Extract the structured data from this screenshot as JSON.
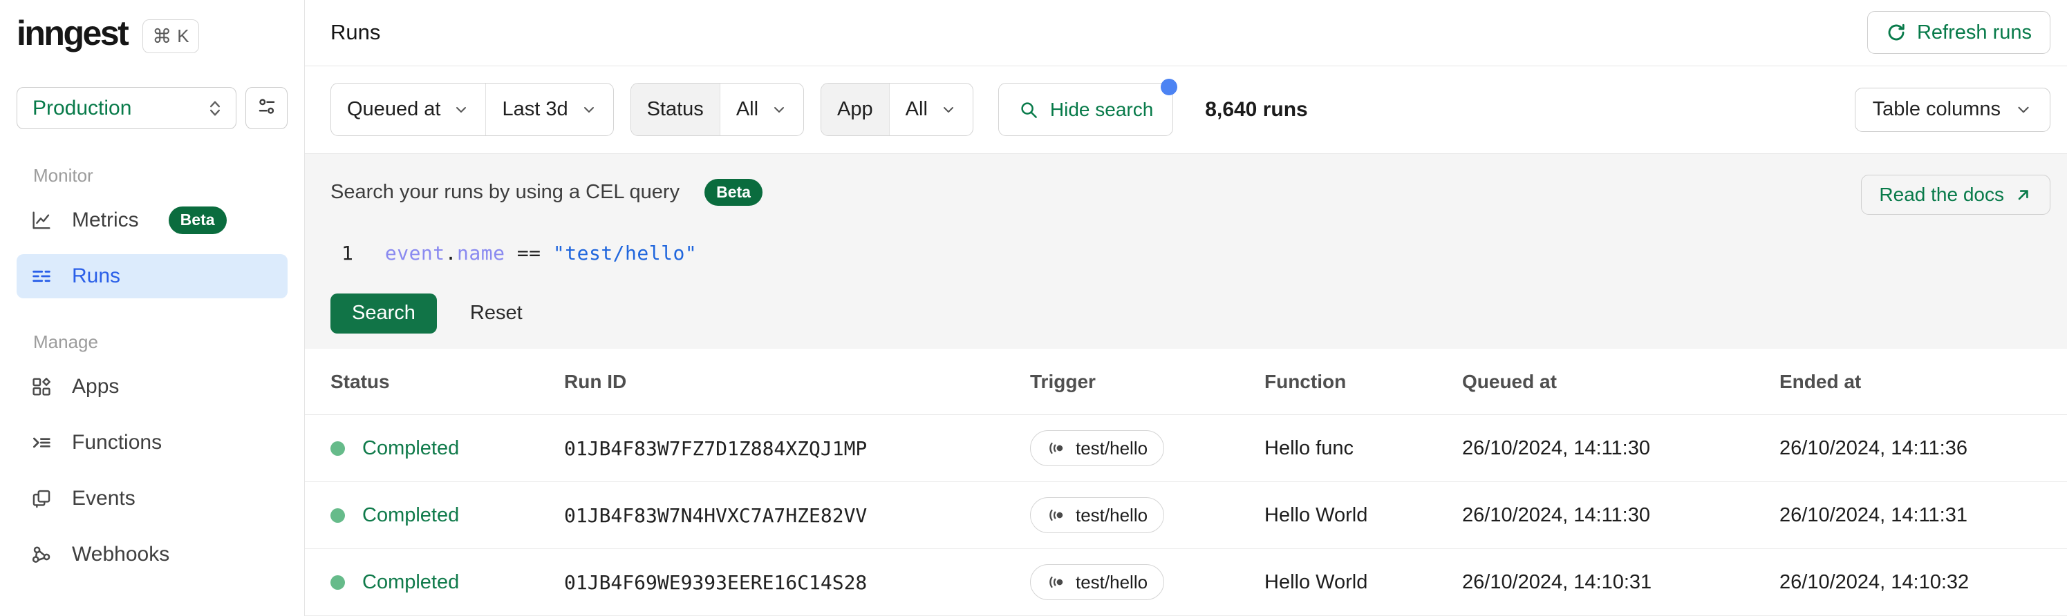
{
  "brand": {
    "logo": "inngest",
    "cmd_symbol": "⌘",
    "shortcut_key": "K"
  },
  "environment": {
    "value": "Production"
  },
  "sidebar": {
    "sections": [
      {
        "label": "Monitor",
        "items": [
          {
            "label": "Metrics",
            "badge": "Beta"
          },
          {
            "label": "Runs"
          }
        ]
      },
      {
        "label": "Manage",
        "items": [
          {
            "label": "Apps"
          },
          {
            "label": "Functions"
          },
          {
            "label": "Events"
          },
          {
            "label": "Webhooks"
          }
        ]
      }
    ]
  },
  "header": {
    "title": "Runs",
    "refresh_label": "Refresh runs"
  },
  "filters": {
    "time_field": "Queued at",
    "time_range": "Last 3d",
    "status_label": "Status",
    "status_value": "All",
    "app_label": "App",
    "app_value": "All",
    "search_toggle_label": "Hide search",
    "runs_count": "8,640 runs",
    "table_columns_label": "Table columns"
  },
  "search_panel": {
    "title": "Search your runs by using a CEL query",
    "beta_label": "Beta",
    "docs_label": "Read the docs",
    "line_number": "1",
    "code": {
      "ident": "event",
      "dot": ".",
      "prop": "name",
      "operator": "==",
      "value": "\"test/hello\""
    },
    "search_label": "Search",
    "reset_label": "Reset"
  },
  "table": {
    "columns": [
      "Status",
      "Run ID",
      "Trigger",
      "Function",
      "Queued at",
      "Ended at"
    ],
    "rows": [
      {
        "status": "Completed",
        "run_id": "01JB4F83W7FZ7D1Z884XZQJ1MP",
        "trigger": "test/hello",
        "function": "Hello func",
        "queued_at": "26/10/2024, 14:11:30",
        "ended_at": "26/10/2024, 14:11:36"
      },
      {
        "status": "Completed",
        "run_id": "01JB4F83W7N4HVXC7A7HZE82VV",
        "trigger": "test/hello",
        "function": "Hello World",
        "queued_at": "26/10/2024, 14:11:30",
        "ended_at": "26/10/2024, 14:11:31"
      },
      {
        "status": "Completed",
        "run_id": "01JB4F69WE9393EERE16C14S28",
        "trigger": "test/hello",
        "function": "Hello World",
        "queued_at": "26/10/2024, 14:10:31",
        "ended_at": "26/10/2024, 14:10:32"
      }
    ]
  },
  "colors": {
    "brand_green": "#077a49",
    "badge_green": "#0a6c3e",
    "active_blue": "#2a5fe8",
    "active_blue_bg": "#dcebfc",
    "status_dot_green": "#66bb8a",
    "notification_blue": "#4c83f3",
    "code_purple": "#8a8af0",
    "code_blue": "#2066dd",
    "panel_gray": "#f5f5f5"
  }
}
